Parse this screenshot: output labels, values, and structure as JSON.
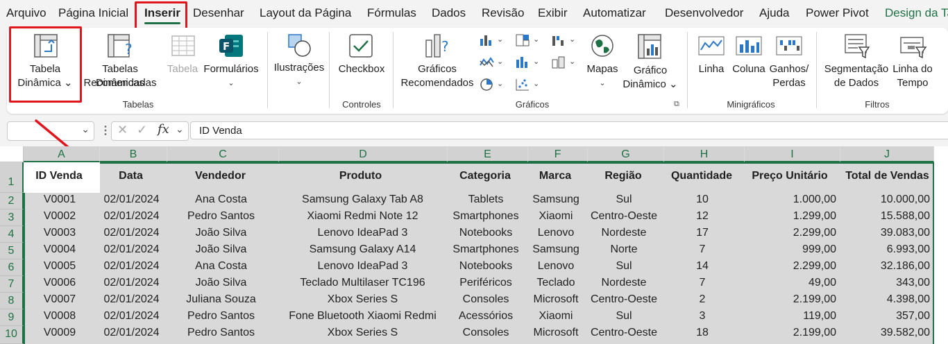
{
  "menu": {
    "tabs": [
      "Arquivo",
      "Página Inicial",
      "Inserir",
      "Desenhar",
      "Layout da Página",
      "Fórmulas",
      "Dados",
      "Revisão",
      "Exibir",
      "Automatizar",
      "Desenvolvedor",
      "Ajuda",
      "Power Pivot",
      "Design da Ta"
    ],
    "active_tab": "Inserir"
  },
  "ribbon": {
    "tabelas": {
      "group_label": "Tabelas",
      "pivot_table": [
        "Tabela",
        "Dinâmica ⌄"
      ],
      "recommended_pivots": [
        "Tabelas Dinâmicas",
        "Recomendadas"
      ],
      "table": "Tabela",
      "forms": "Formulários"
    },
    "ilustracoes": {
      "label": "Ilustrações"
    },
    "controles": {
      "group_label": "Controles",
      "checkbox": "Checkbox"
    },
    "graficos": {
      "group_label": "Gráficos",
      "recommended": [
        "Gráficos",
        "Recomendados"
      ],
      "maps": "Mapas",
      "pivot_chart": [
        "Gráfico",
        "Dinâmico ⌄"
      ]
    },
    "minigraficos": {
      "group_label": "Minigráficos",
      "line": "Linha",
      "column": "Coluna",
      "winloss": [
        "Ganhos/",
        "Perdas"
      ]
    },
    "filtros": {
      "group_label": "Filtros",
      "slicer": [
        "Segmentação",
        "de Dados"
      ],
      "timeline": [
        "Linha do",
        "Tempo"
      ]
    }
  },
  "formula_bar": {
    "name_box": "",
    "fx": "fx",
    "content": "ID Venda"
  },
  "sheet": {
    "columns": [
      "A",
      "B",
      "C",
      "D",
      "E",
      "F",
      "G",
      "H",
      "I",
      "J"
    ],
    "rows": [
      "1",
      "2",
      "3",
      "4",
      "5",
      "6",
      "7",
      "8",
      "9",
      "10"
    ],
    "headers": [
      "ID Venda",
      "Data",
      "Vendedor",
      "Produto",
      "Categoria",
      "Marca",
      "Região",
      "Quantidade",
      "Preço Unitário",
      "Total de Vendas"
    ],
    "data": [
      [
        "V0001",
        "02/01/2024",
        "Ana Costa",
        "Samsung Galaxy Tab A8",
        "Tablets",
        "Samsung",
        "Sul",
        "10",
        "1.000,00",
        "10.000,00"
      ],
      [
        "V0002",
        "02/01/2024",
        "Pedro Santos",
        "Xiaomi Redmi Note 12",
        "Smartphones",
        "Xiaomi",
        "Centro-Oeste",
        "12",
        "1.299,00",
        "15.588,00"
      ],
      [
        "V0003",
        "02/01/2024",
        "João Silva",
        "Lenovo IdeaPad 3",
        "Notebooks",
        "Lenovo",
        "Nordeste",
        "17",
        "2.299,00",
        "39.083,00"
      ],
      [
        "V0004",
        "02/01/2024",
        "João Silva",
        "Samsung Galaxy A14",
        "Smartphones",
        "Samsung",
        "Norte",
        "7",
        "999,00",
        "6.993,00"
      ],
      [
        "V0005",
        "02/01/2024",
        "Ana Costa",
        "Lenovo IdeaPad 3",
        "Notebooks",
        "Lenovo",
        "Sul",
        "14",
        "2.299,00",
        "32.186,00"
      ],
      [
        "V0006",
        "02/01/2024",
        "João Silva",
        "Teclado Multilaser TC196",
        "Periféricos",
        "Teclado",
        "Nordeste",
        "7",
        "49,00",
        "343,00"
      ],
      [
        "V0007",
        "02/01/2024",
        "Juliana Souza",
        "Xbox Series S",
        "Consoles",
        "Microsoft",
        "Centro-Oeste",
        "2",
        "2.199,00",
        "4.398,00"
      ],
      [
        "V0008",
        "02/01/2024",
        "Pedro Santos",
        "Fone Bluetooth Xiaomi Redmi",
        "Acessórios",
        "Xiaomi",
        "Sul",
        "3",
        "119,00",
        "357,00"
      ],
      [
        "V0009",
        "02/01/2024",
        "Pedro Santos",
        "Xbox Series S",
        "Consoles",
        "Microsoft",
        "Centro-Oeste",
        "18",
        "2.199,00",
        "39.582,00"
      ]
    ]
  },
  "colors": {
    "accent": "#1e7145",
    "highlight": "#e0161c",
    "selection": "#d9d9d9"
  }
}
